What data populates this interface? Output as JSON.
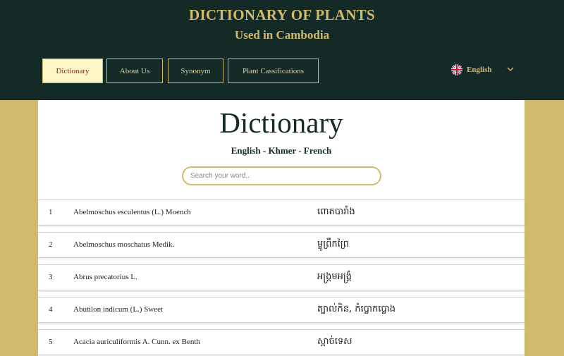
{
  "header": {
    "title": "DICTIONARY OF PLANTS",
    "subtitle": "Used in Cambodia"
  },
  "nav": {
    "dictionary": "Dictionary",
    "about": "About Us",
    "synonym": "Synonym",
    "classifications": "Plant Cassifications",
    "active": "dictionary"
  },
  "language": {
    "label": "English",
    "icon": "uk-flag-icon"
  },
  "main": {
    "title": "Dictionary",
    "subtitle": "English - Khmer - French",
    "search_placeholder": "Search your word.."
  },
  "entries": [
    {
      "num": "1",
      "name": "Abelmoschus esculentus (L.) Moench",
      "khmer": "ពោតបារាំង"
    },
    {
      "num": "2",
      "name": "Abelmoschus moschatus Medik.",
      "khmer": "ម្លូព្រឹកព្រៃ"
    },
    {
      "num": "3",
      "name": "Abrus precatorius L.",
      "khmer": "អង្គ្រមអង្គ្រំ"
    },
    {
      "num": "4",
      "name": "Abutilon indicum (L.) Sweet",
      "khmer": "ត្បាល់កិន, កំប្លោកប្លោង"
    },
    {
      "num": "5",
      "name": "Acacia auriculiformis A. Cunn. ex Benth",
      "khmer": "ស្ពាច់ទេស"
    }
  ],
  "colors": {
    "header_bg": "#132a26",
    "gold": "#d2ba6c",
    "active_nav_bg": "#fdf6c6",
    "active_nav_text": "#8c1d1d"
  }
}
